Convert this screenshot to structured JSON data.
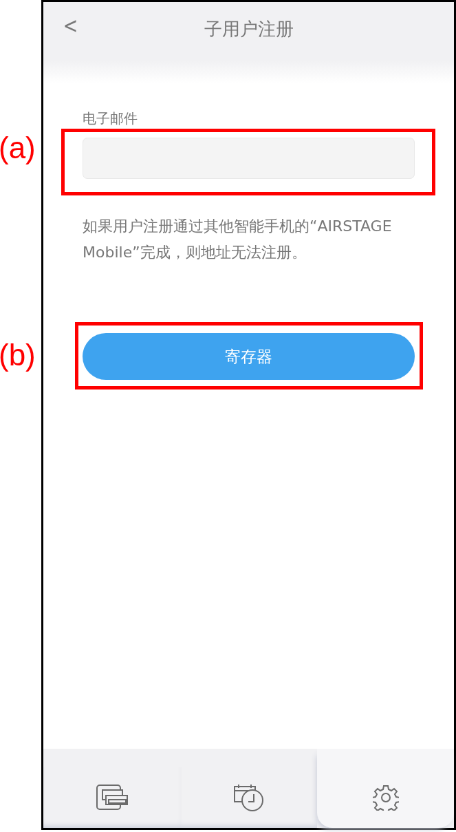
{
  "header": {
    "back": "<",
    "title": "子用户注册"
  },
  "email_field": {
    "label": "电子邮件"
  },
  "note": "如果用户注册通过其他智能手机的“AIRSTAGE Mobile”完成，则地址无法注册。",
  "register_button": {
    "label": "寄存器"
  },
  "annotations": [
    {
      "label": "(a)"
    },
    {
      "label": "(b)"
    }
  ],
  "tabs": [
    {
      "kind": "units",
      "selected": false
    },
    {
      "kind": "schedule",
      "selected": false
    },
    {
      "kind": "settings",
      "selected": true
    }
  ]
}
